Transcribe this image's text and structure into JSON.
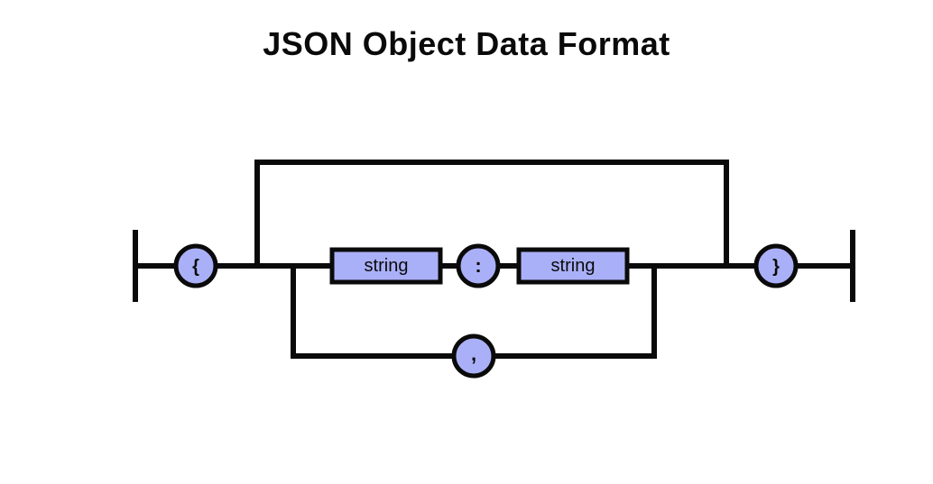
{
  "title": "JSON Object Data Format",
  "nodes": {
    "open_brace": "{",
    "string1": "string",
    "colon": ":",
    "string2": "string",
    "comma": ",",
    "close_brace": "}"
  },
  "colors": {
    "fill": "#AAB0F7",
    "stroke": "#0a0a0a",
    "text": "#0a0a0a"
  }
}
